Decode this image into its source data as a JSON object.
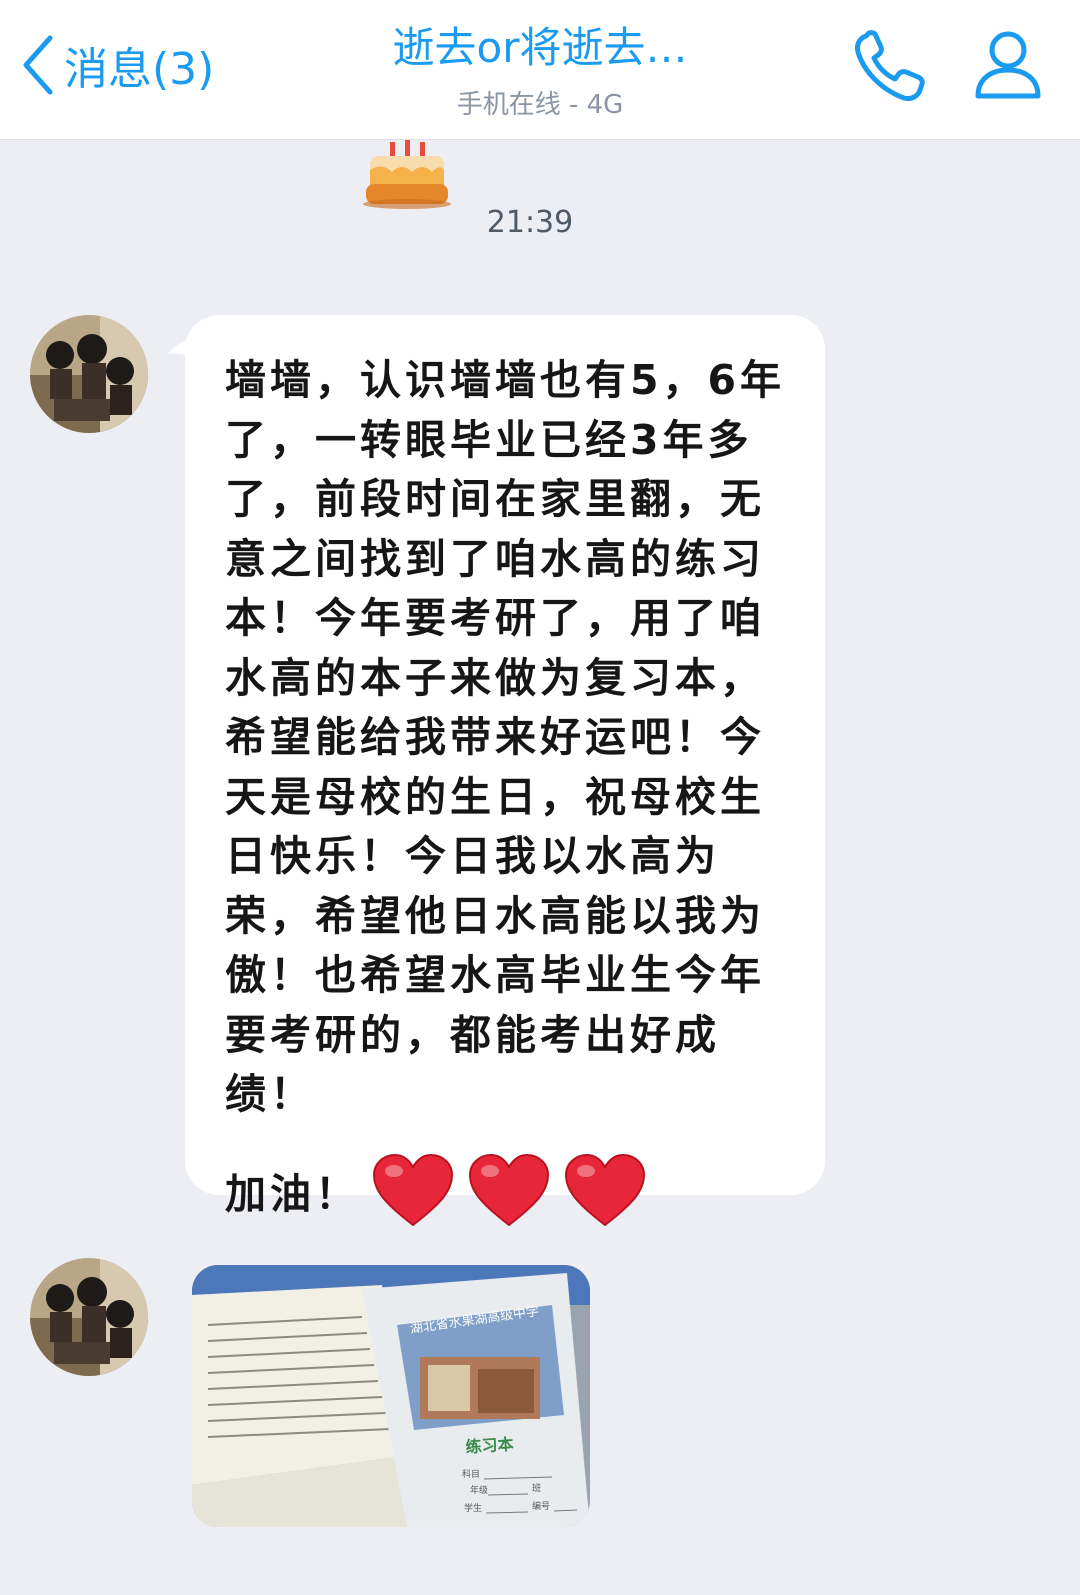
{
  "header": {
    "back_label": "消息(3)",
    "title": "逝去or将逝去…",
    "status": "手机在线 - 4G",
    "accent_color": "#1a9bf0"
  },
  "icons": {
    "back": "chevron-left-icon",
    "call": "phone-icon",
    "profile": "person-icon",
    "cake": "birthday-cake-emoji",
    "heart": "red-heart-emoji"
  },
  "chat": {
    "timestamp": "21:39",
    "message_text": "墙墙，认识墙墙也有5，6年了，一转眼毕业已经3年多了，前段时间在家里翻，无意之间找到了咱水高的练习本！今年要考研了，用了咱水高的本子来做为复习本，希望能给我带来好运吧！今天是母校的生日，祝母校生日快乐！今日我以水高为荣，希望他日水高能以我为傲！也希望水高毕业生今年要考研的，都能考出好成绩！",
    "message_closing": "加油！",
    "heart_count": 3,
    "photo": {
      "cover_title": "湖北省水果湖高级中学",
      "cover_label": "练习本",
      "field_subject": "科目",
      "field_grade": "年级",
      "field_class": "班",
      "field_student": "学生",
      "field_number": "编号"
    }
  }
}
